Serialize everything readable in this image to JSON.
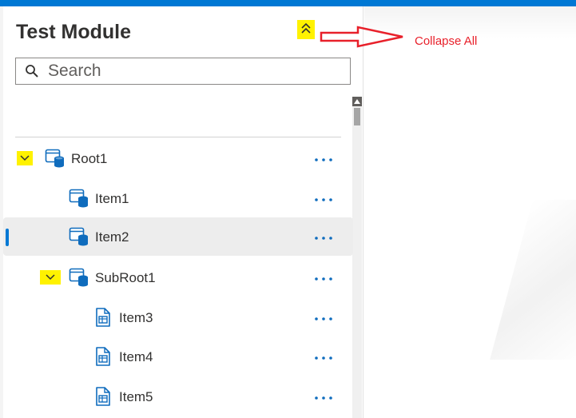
{
  "header": {
    "title": "Test Module",
    "collapse_all_icon": "double-chevron-up-icon"
  },
  "annotation": {
    "text": "Collapse All",
    "color": "#e8202a"
  },
  "search": {
    "placeholder": "Search",
    "value": ""
  },
  "tree": {
    "items": [
      {
        "label": "Root1",
        "icon": "database-icon",
        "expandable": true,
        "expanded": true,
        "selected": false
      },
      {
        "label": "Item1",
        "icon": "database-icon",
        "expandable": false,
        "selected": false
      },
      {
        "label": "Item2",
        "icon": "database-icon",
        "expandable": false,
        "selected": true
      },
      {
        "label": "SubRoot1",
        "icon": "database-icon",
        "expandable": true,
        "expanded": true,
        "selected": false
      },
      {
        "label": "Item3",
        "icon": "table-document-icon",
        "expandable": false,
        "selected": false
      },
      {
        "label": "Item4",
        "icon": "table-document-icon",
        "expandable": false,
        "selected": false
      },
      {
        "label": "Item5",
        "icon": "table-document-icon",
        "expandable": false,
        "selected": false
      }
    ],
    "more_icon": "more-horizontal-icon"
  },
  "colors": {
    "accent": "#0078d4",
    "highlight": "#fff200",
    "selected_bg": "#ededed"
  }
}
